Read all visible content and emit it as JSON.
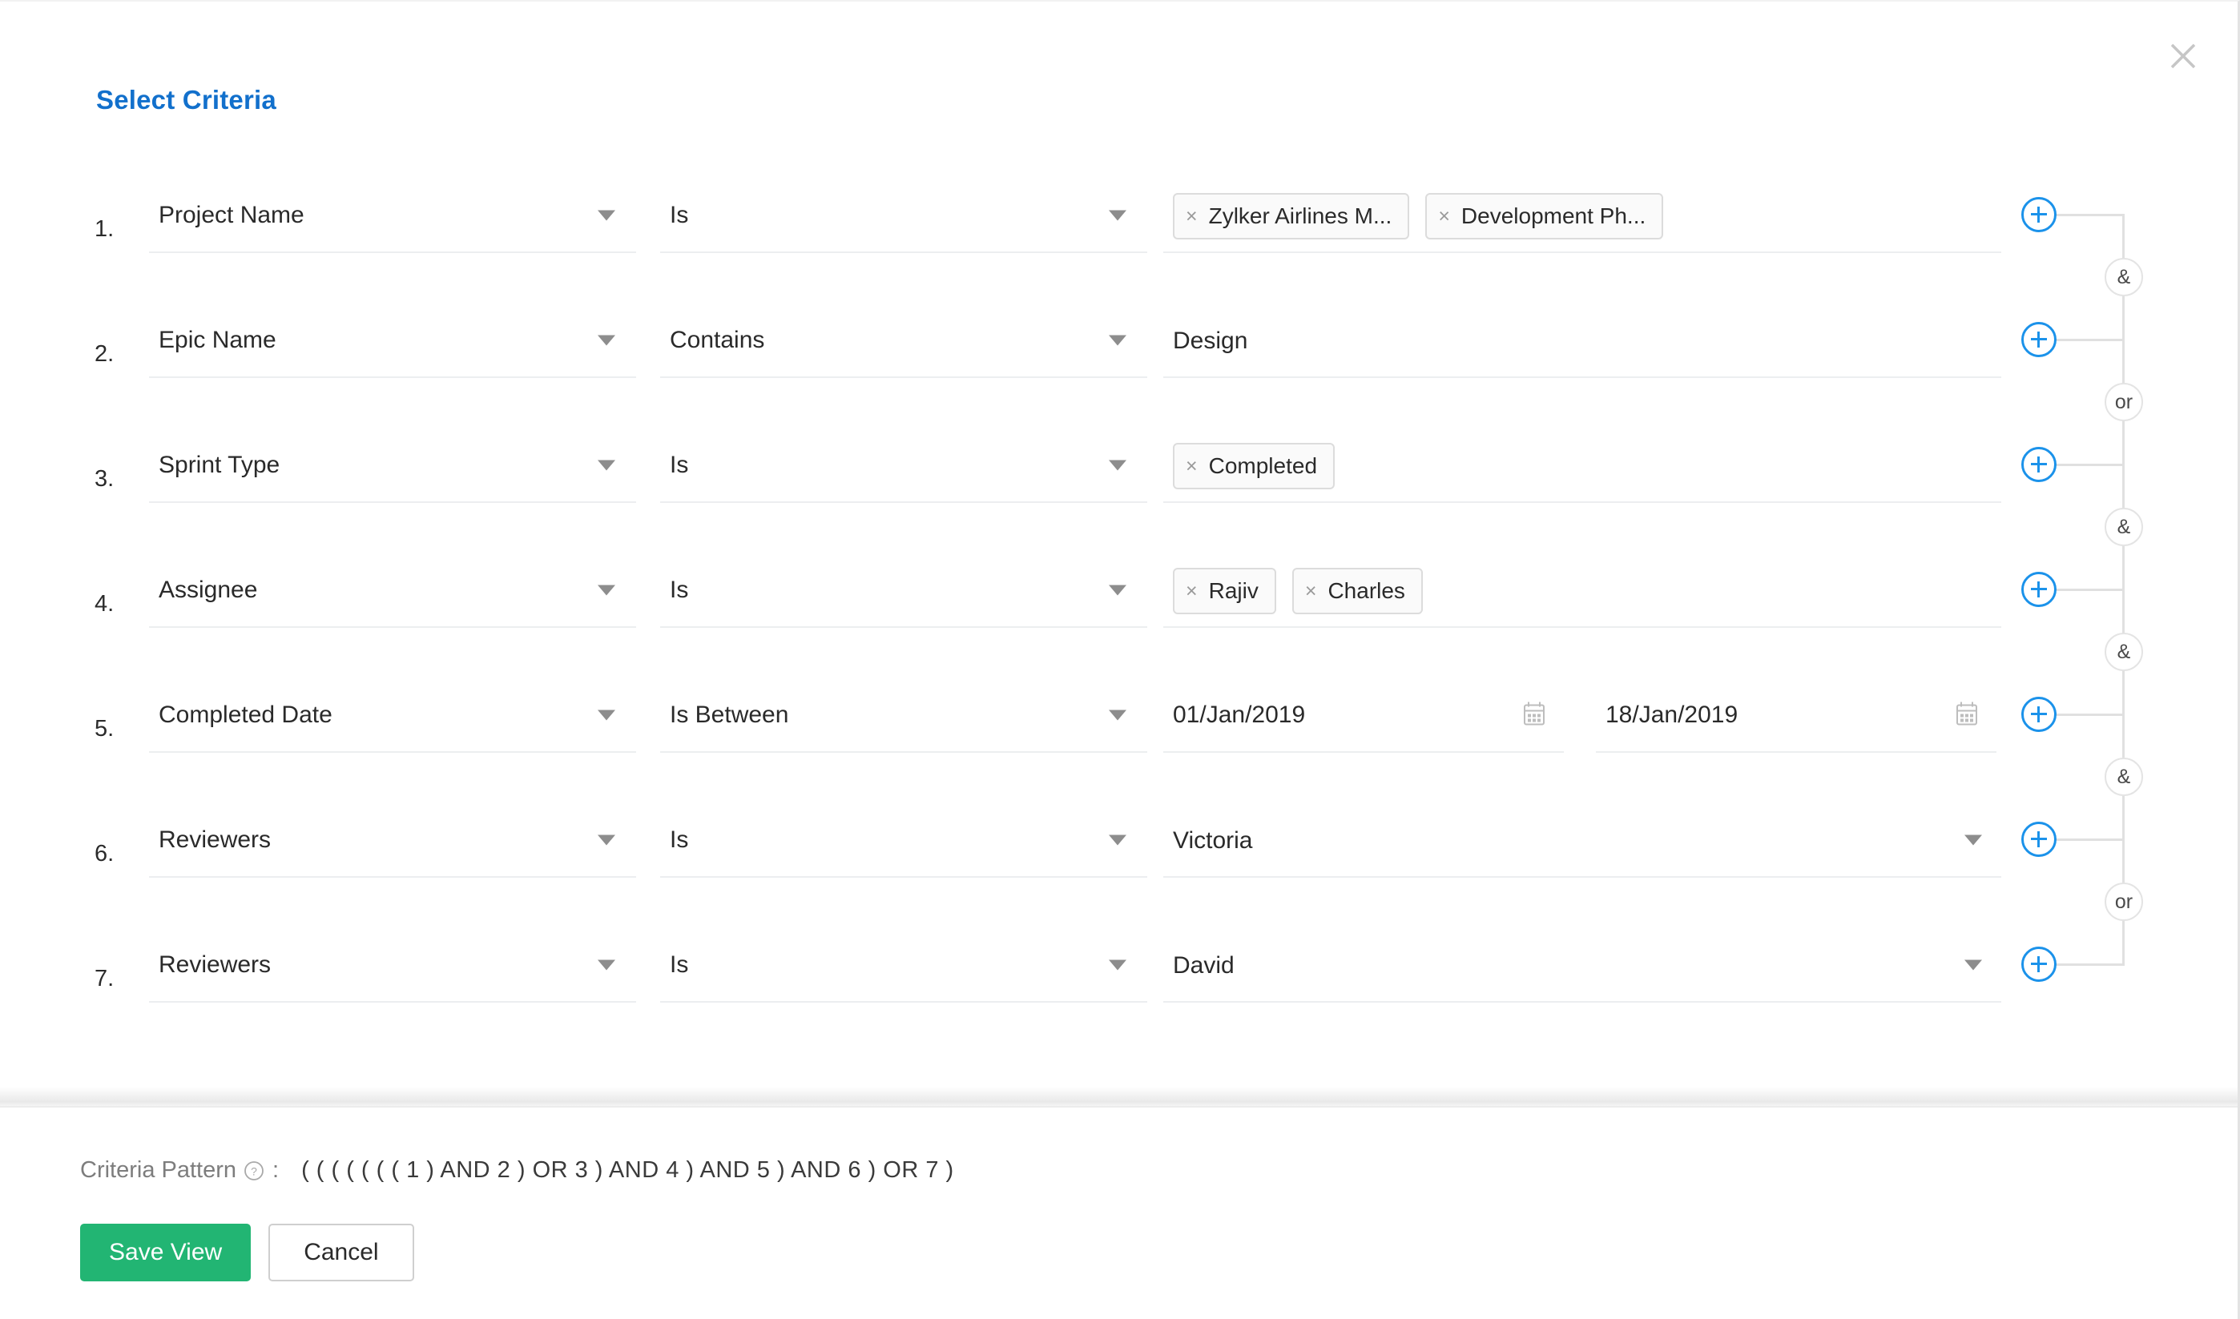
{
  "dialog": {
    "title": "Select Criteria",
    "close_icon": "close-icon"
  },
  "criteria": {
    "rows": [
      {
        "index": "1.",
        "field": "Project Name",
        "operator": "Is",
        "value_type": "chips",
        "chips": [
          "Zylker Airlines M...",
          "Development Ph..."
        ]
      },
      {
        "index": "2.",
        "field": "Epic Name",
        "operator": "Contains",
        "value_type": "text",
        "value": "Design"
      },
      {
        "index": "3.",
        "field": "Sprint Type",
        "operator": "Is",
        "value_type": "chips",
        "chips": [
          "Completed"
        ]
      },
      {
        "index": "4.",
        "field": "Assignee",
        "operator": "Is",
        "value_type": "chips",
        "chips": [
          "Rajiv",
          "Charles"
        ]
      },
      {
        "index": "5.",
        "field": "Completed Date",
        "operator": "Is Between",
        "value_type": "date-range",
        "date_from": "01/Jan/2019",
        "date_to": "18/Jan/2019"
      },
      {
        "index": "6.",
        "field": "Reviewers",
        "operator": "Is",
        "value_type": "select",
        "value": "Victoria"
      },
      {
        "index": "7.",
        "field": "Reviewers",
        "operator": "Is",
        "value_type": "select",
        "value": "David"
      }
    ],
    "add_row_icon": "plus-circle-icon",
    "connectors": [
      "&",
      "or",
      "&",
      "&",
      "&",
      "or"
    ]
  },
  "footer": {
    "pattern_label": "Criteria Pattern",
    "help_icon": "question-mark-icon",
    "colon": ":",
    "pattern_value": "( ( ( ( ( ( ( 1 ) AND 2 ) OR 3 ) AND 4 ) AND 5 ) AND 6 ) OR 7 )",
    "save_label": "Save View",
    "cancel_label": "Cancel"
  },
  "colors": {
    "title_blue": "#1270cc",
    "save_green": "#22b573",
    "plus_blue": "#1b92ea",
    "underline_gray": "#eceef0"
  }
}
